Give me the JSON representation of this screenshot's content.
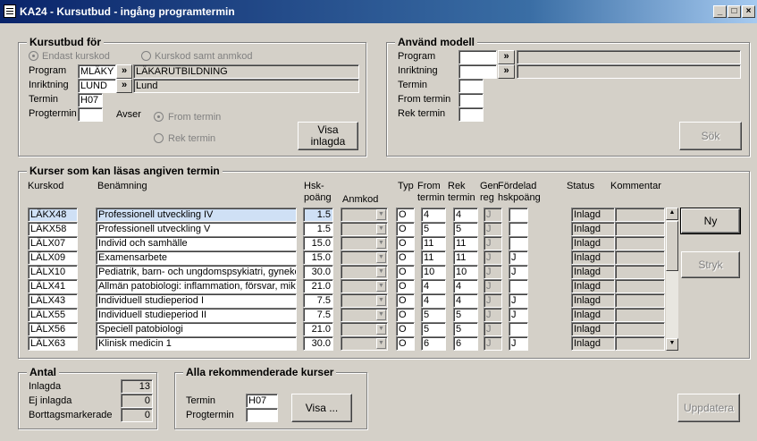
{
  "window": {
    "title": "KA24 - Kursutbud - ingång programtermin",
    "minimize": "_",
    "maximize": "□",
    "close": "×"
  },
  "kursutbud": {
    "label": "Kursutbud för",
    "radio_endast": "Endast kurskod",
    "radio_samt": "Kurskod samt anmkod",
    "program_label": "Program",
    "program_code": "MLÄKY",
    "program_name": "LÄKARUTBILDNING",
    "inriktning_label": "Inriktning",
    "inriktning_code": "LUND",
    "inriktning_name": "Lund",
    "termin_label": "Termin",
    "termin_value": "H07",
    "progtermin_label": "Progtermin",
    "progtermin_value": "",
    "avser_label": "Avser",
    "radio_from": "From termin",
    "radio_rek": "Rek termin",
    "visa_inlagda": "Visa\ninlagda",
    "lookup": "»"
  },
  "modell": {
    "label": "Använd modell",
    "program_label": "Program",
    "inriktning_label": "Inriktning",
    "termin_label": "Termin",
    "from_label": "From termin",
    "rek_label": "Rek termin",
    "sok": "Sök"
  },
  "kurser": {
    "label": "Kurser som kan läsas angiven termin",
    "headers": {
      "kurskod": "Kurskod",
      "benamning": "Benämning",
      "hsk1": "Hsk-",
      "hsk2": "poäng",
      "anmkod": "Anmkod",
      "typ": "Typ",
      "from1": "From",
      "from2": "termin",
      "rek1": "Rek",
      "rek2": "termin",
      "gen1": "Gen",
      "gen2": "reg",
      "ford1": "Fördelad",
      "ford2": "hskpoäng",
      "status": "Status",
      "kommentar": "Kommentar"
    },
    "rows": [
      {
        "kod": "LÄKX48",
        "namn": "Professionell utveckling IV",
        "hsk": "1.5",
        "typ": "O",
        "from": "4",
        "rek": "4",
        "gen": "J",
        "ford": "",
        "status": "Inlagd"
      },
      {
        "kod": "LÄKX58",
        "namn": "Professionell utveckling V",
        "hsk": "1.5",
        "typ": "O",
        "from": "5",
        "rek": "5",
        "gen": "J",
        "ford": "",
        "status": "Inlagd"
      },
      {
        "kod": "LÄLX07",
        "namn": "Individ och samhälle",
        "hsk": "15.0",
        "typ": "O",
        "from": "11",
        "rek": "11",
        "gen": "J",
        "ford": "",
        "status": "Inlagd"
      },
      {
        "kod": "LÄLX09",
        "namn": "Examensarbete",
        "hsk": "15.0",
        "typ": "O",
        "from": "11",
        "rek": "11",
        "gen": "J",
        "ford": "J",
        "status": "Inlagd"
      },
      {
        "kod": "LÄLX10",
        "namn": "Pediatrik, barn- och ungdomspsykiatri, gyneko",
        "hsk": "30.0",
        "typ": "O",
        "from": "10",
        "rek": "10",
        "gen": "J",
        "ford": "J",
        "status": "Inlagd"
      },
      {
        "kod": "LÄLX41",
        "namn": "Allmän patobiologi: inflammation, försvar, mikro",
        "hsk": "21.0",
        "typ": "O",
        "from": "4",
        "rek": "4",
        "gen": "J",
        "ford": "",
        "status": "Inlagd"
      },
      {
        "kod": "LÄLX43",
        "namn": "Individuell studieperiod I",
        "hsk": "7.5",
        "typ": "O",
        "from": "4",
        "rek": "4",
        "gen": "J",
        "ford": "J",
        "status": "Inlagd"
      },
      {
        "kod": "LÄLX55",
        "namn": "Individuell studieperiod II",
        "hsk": "7.5",
        "typ": "O",
        "from": "5",
        "rek": "5",
        "gen": "J",
        "ford": "J",
        "status": "Inlagd"
      },
      {
        "kod": "LÄLX56",
        "namn": "Speciell patobiologi",
        "hsk": "21.0",
        "typ": "O",
        "from": "5",
        "rek": "5",
        "gen": "J",
        "ford": "",
        "status": "Inlagd"
      },
      {
        "kod": "LÄLX63",
        "namn": "Klinisk medicin 1",
        "hsk": "30.0",
        "typ": "O",
        "from": "6",
        "rek": "6",
        "gen": "J",
        "ford": "J",
        "status": "Inlagd"
      }
    ],
    "ny": "Ny",
    "stryk": "Stryk"
  },
  "antal": {
    "label": "Antal",
    "inlagda_label": "Inlagda",
    "inlagda_value": "13",
    "ej_label": "Ej inlagda",
    "ej_value": "0",
    "borttag_label": "Borttagsmarkerade",
    "borttag_value": "0"
  },
  "alla": {
    "label": "Alla rekommenderade kurser",
    "termin_label": "Termin",
    "termin_value": "H07",
    "progtermin_label": "Progtermin",
    "progtermin_value": "",
    "visa": "Visa ..."
  },
  "uppdatera": "Uppdatera",
  "colors": {
    "titlebar_start": "#0a246a",
    "titlebar_end": "#a6caf0",
    "face": "#d4d0c8",
    "selected_row": "#cfe0f5"
  }
}
